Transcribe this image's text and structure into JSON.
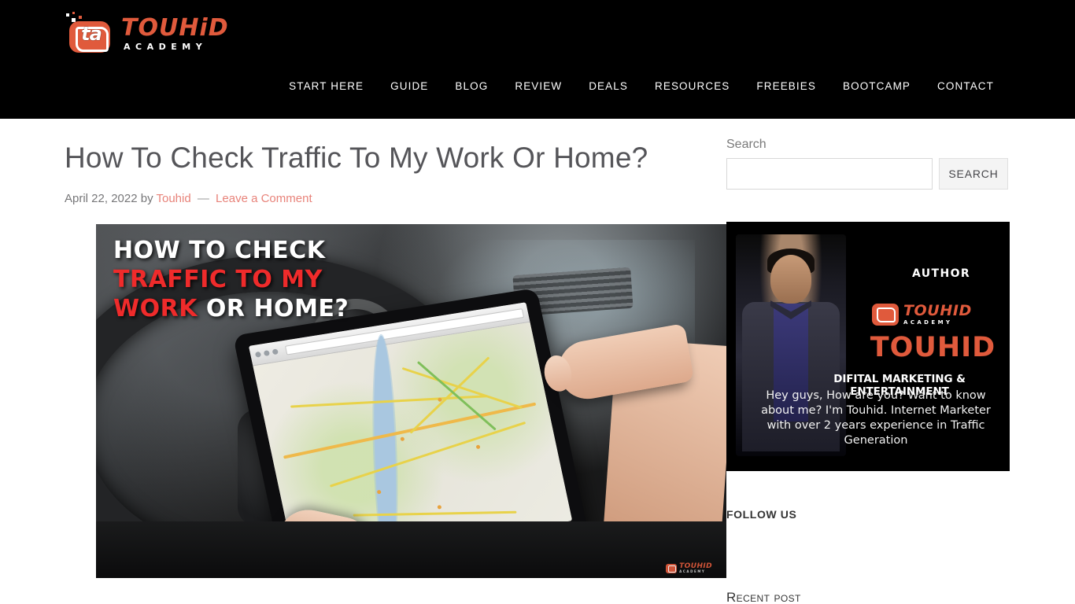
{
  "header": {
    "logo": {
      "mark_icon": "ta-logo-icon",
      "word": "TOUHiD",
      "sub": "ACADEMY"
    },
    "nav": [
      {
        "label": "START HERE"
      },
      {
        "label": "GUIDE"
      },
      {
        "label": "BLOG"
      },
      {
        "label": "REVIEW"
      },
      {
        "label": "DEALS"
      },
      {
        "label": "RESOURCES"
      },
      {
        "label": "FREEBIES"
      },
      {
        "label": "BOOTCAMP"
      },
      {
        "label": "CONTACT"
      }
    ],
    "background_color": "#000000",
    "accent_color": "#e05a3c"
  },
  "post": {
    "title": "How To Check Traffic To My Work Or Home?",
    "date": "April 22, 2022",
    "by_text": "by",
    "author": "Touhid",
    "separator": "—",
    "comments_link": "Leave a Comment",
    "link_color": "#e8837a",
    "featured_image": {
      "overlay_line1": "HOW TO CHECK",
      "overlay_line2": "TRAFFIC TO MY",
      "overlay_line3_red": "WORK",
      "overlay_line3_white": "OR HOME?",
      "overlay_white": "#ffffff",
      "overlay_red": "#ef2b2b",
      "watermark_word": "TOUHID",
      "watermark_sub": "ACADEMY",
      "alt": "Hand holding a tablet showing a traffic map inside a car"
    }
  },
  "sidebar": {
    "search": {
      "label": "Search",
      "value": "",
      "placeholder": "",
      "button_label": "SEARCH"
    },
    "author_card": {
      "label": "AUTHOR",
      "logo_word": "TOUHID",
      "logo_sub": "ACADEMY",
      "name": "TOUHID",
      "tagline": "DIFITAL MARKETING & ENTERTAINMENT",
      "bio": "Hey guys, How are you? Want to know about me? I'm Touhid. Internet Marketer with over 2 years experience in Traffic Generation",
      "background_color": "#000000",
      "name_color": "#e05a3c"
    },
    "follow_us_title": "FOLLOW US",
    "recent_post_title": "Recent post"
  }
}
